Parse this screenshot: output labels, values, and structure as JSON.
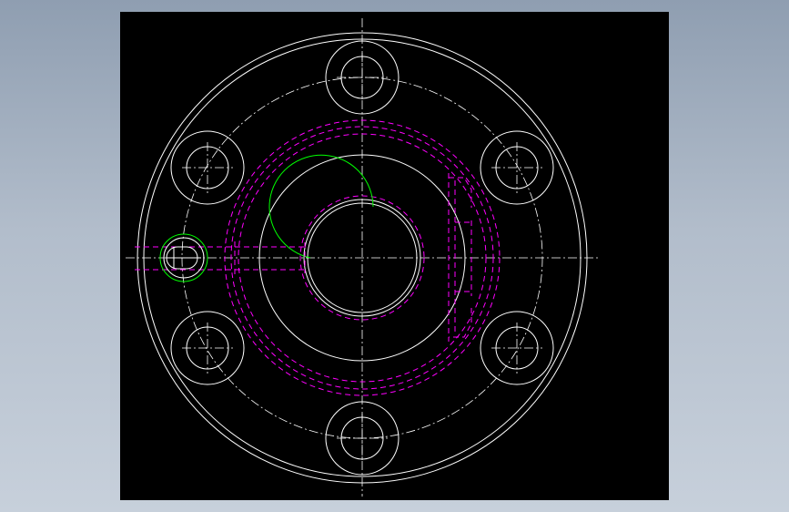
{
  "drawing": {
    "background_color": "#000000",
    "colors": {
      "outline": "#ffffff",
      "hidden": "#ff00ff",
      "center": "#ffffff",
      "accent": "#00ff00"
    }
  }
}
